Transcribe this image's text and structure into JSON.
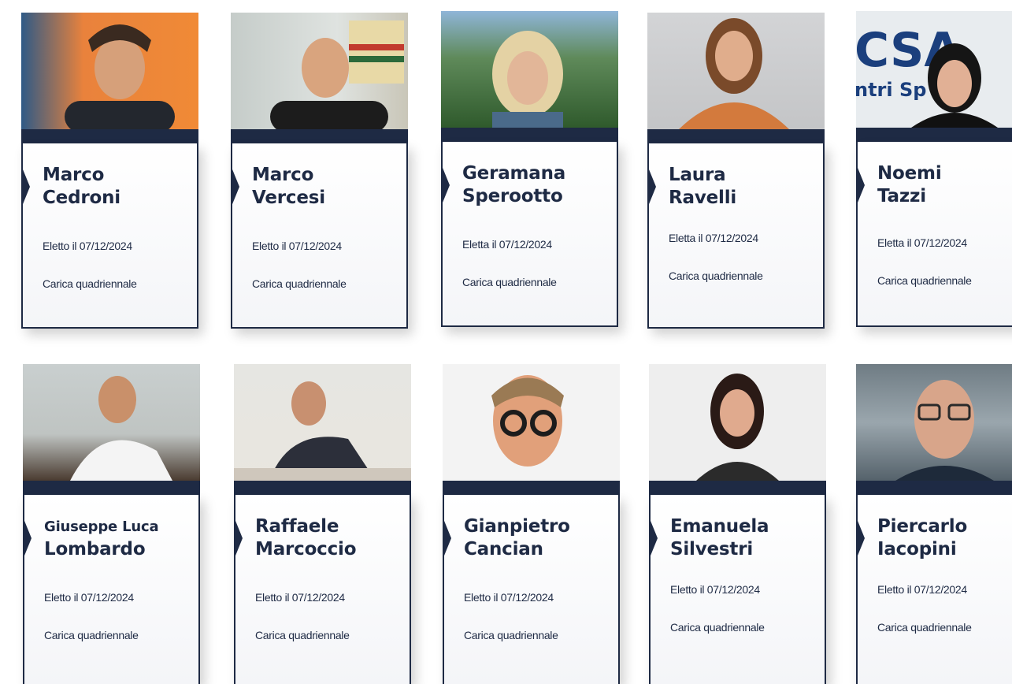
{
  "members": [
    {
      "first": "Marco",
      "last": "Cedroni",
      "elected": "Eletto il 07/12/2024",
      "term": "Carica quadriennale",
      "photo_colors": [
        "#e9823c",
        "#3a5c8a",
        "#2b2f36"
      ]
    },
    {
      "first": "Marco",
      "last": "Vercesi",
      "elected": "Eletto il 07/12/2024",
      "term": "Carica quadriennale",
      "photo_colors": [
        "#c9d1cf",
        "#d7b98c",
        "#1e1e1e"
      ]
    },
    {
      "first": "Geramana",
      "last": "Sperootto",
      "elected": "Eletta  il 07/12/2024",
      "term": "Carica quadriennale",
      "photo_colors": [
        "#3d6b3a",
        "#e4d2a4",
        "#8fb5d8"
      ]
    },
    {
      "first": "Laura",
      "last": "Ravelli",
      "elected": "Eletta il 07/12/2024",
      "term": "Carica quadriennale",
      "photo_colors": [
        "#cfd0d2",
        "#d37a3d",
        "#7a4a2a"
      ]
    },
    {
      "first": "Noemi",
      "last": "Tazzi",
      "elected": "Eletta il 07/12/2024",
      "term": "Carica quadriennale",
      "photo_colors": [
        "#e8ecef",
        "#1b3f7d",
        "#111111"
      ]
    },
    {
      "first": "Giuseppe Luca",
      "last": "Lombardo",
      "elected": "Eletto il 07/12/2024",
      "term": "Carica quadriennale",
      "photo_colors": [
        "#c9cfcf",
        "#4a3b30",
        "#f2f2f2"
      ]
    },
    {
      "first": "Raffaele",
      "last": "Marcoccio",
      "elected": "Eletto il 07/12/2024",
      "term": "Carica quadriennale",
      "photo_colors": [
        "#e6e6e2",
        "#2c2f3a",
        "#d9d0c6"
      ]
    },
    {
      "first": "Gianpietro",
      "last": "Cancian",
      "elected": "Eletto il 07/12/2024",
      "term": "Carica quadriennale",
      "photo_colors": [
        "#f3f3f3",
        "#e1a07a",
        "#1c1c1c"
      ]
    },
    {
      "first": "Emanuela",
      "last": "Silvestri",
      "elected": "Eletto il 07/12/2024",
      "term": "Carica quadriennale",
      "photo_colors": [
        "#eeeeee",
        "#2a1a16",
        "#e0aa8e"
      ]
    },
    {
      "first": "Piercarlo",
      "last": "Iacopini",
      "elected": "Eletto il 07/12/2024",
      "term": "Carica quadriennale",
      "photo_colors": [
        "#7b8a92",
        "#d8a58a",
        "#1e2a3a"
      ]
    }
  ]
}
